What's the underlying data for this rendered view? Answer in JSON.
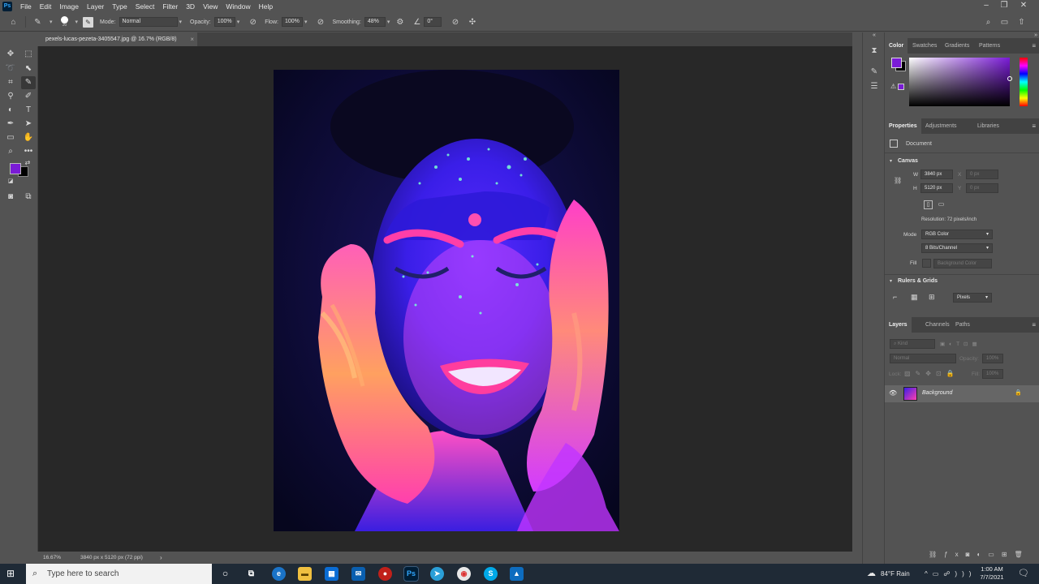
{
  "menubar": {
    "logo": "Ps",
    "items": [
      "File",
      "Edit",
      "Image",
      "Layer",
      "Type",
      "Select",
      "Filter",
      "3D",
      "View",
      "Window",
      "Help"
    ]
  },
  "options": {
    "brush_size": "30",
    "mode_label": "Mode:",
    "mode_value": "Normal",
    "opacity_label": "Opacity:",
    "opacity_value": "100%",
    "flow_label": "Flow:",
    "flow_value": "100%",
    "smoothing_label": "Smoothing:",
    "smoothing_value": "48%",
    "angle_value": "0°"
  },
  "document": {
    "tab_title": "pexels-lucas-pezeta-3405547.jpg @ 16.7% (RGB/8)",
    "zoom": "16.67%",
    "status_info": "3840 px x 5120 px (72 ppi)"
  },
  "colors": {
    "foreground": "#7a1bd6",
    "background": "#000000",
    "ui_bg": "#535353",
    "canvas_bg": "#282828"
  },
  "color_panel": {
    "tabs": [
      "Color",
      "Swatches",
      "Gradients",
      "Patterns"
    ],
    "active": "Color"
  },
  "properties_panel": {
    "tabs": [
      "Properties",
      "Adjustments",
      "Libraries"
    ],
    "active": "Properties",
    "doc_label": "Document",
    "canvas_title": "Canvas",
    "w_label": "W",
    "w_value": "3840 px",
    "h_label": "H",
    "h_value": "5120 px",
    "x_label": "X",
    "x_value": "0 px",
    "y_label": "Y",
    "y_value": "0 px",
    "resolution": "Resolution: 72 pixels/inch",
    "mode_label": "Mode",
    "mode_value": "RGB Color",
    "depth_value": "8 Bits/Channel",
    "fill_label": "Fill",
    "fill_value": "Background Color",
    "rulers_title": "Rulers & Grids",
    "units_value": "Pixels"
  },
  "layers_panel": {
    "tabs": [
      "Layers",
      "Channels",
      "Paths"
    ],
    "active": "Layers",
    "kind_placeholder": "Kind",
    "blend_value": "Normal",
    "opacity_label": "Opacity:",
    "opacity_value": "100%",
    "lock_label": "Lock:",
    "fill_label": "Fill:",
    "fill_value": "100%",
    "layers": [
      {
        "name": "Background",
        "visible": true,
        "locked": true
      }
    ]
  },
  "taskbar": {
    "search_placeholder": "Type here to search",
    "weather": "84°F  Rain",
    "time": "1:00 AM",
    "date": "7/7/2021"
  }
}
